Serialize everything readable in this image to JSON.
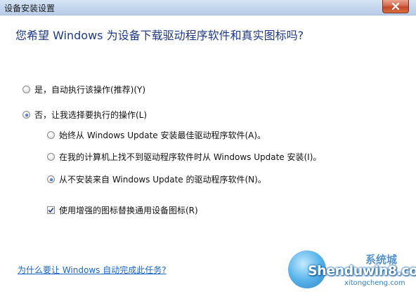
{
  "window": {
    "title": "设备安装设置"
  },
  "heading": "您希望 Windows 为设备下载驱动程序软件和真实图标吗?",
  "options": {
    "yes": {
      "label": "是，自动执行该操作(推荐)(Y)",
      "checked": false
    },
    "no": {
      "label": "否，让我选择要执行的操作(L)",
      "checked": true
    },
    "sub_always": {
      "label": "始终从 Windows Update 安装最佳驱动程序软件(A)。",
      "checked": false
    },
    "sub_fallback": {
      "label": "在我的计算机上找不到驱动程序软件时从 Windows Update 安装(I)。",
      "checked": false
    },
    "sub_never": {
      "label": "从不安装来自 Windows Update 的驱动程序软件(N)。",
      "checked": true
    },
    "enhanced_icons": {
      "label": "使用增强的图标替换通用设备图标(R)",
      "checked": true
    }
  },
  "help_link": "为什么要让 Windows 自动完成此任务?",
  "watermark": {
    "main": "Shenduwin8.com",
    "sub": "xitongcheng.com",
    "tag": "系统城"
  },
  "colors": {
    "heading": "#1e3a8a",
    "link": "#1a66c8",
    "close_button": "#c4472a"
  }
}
